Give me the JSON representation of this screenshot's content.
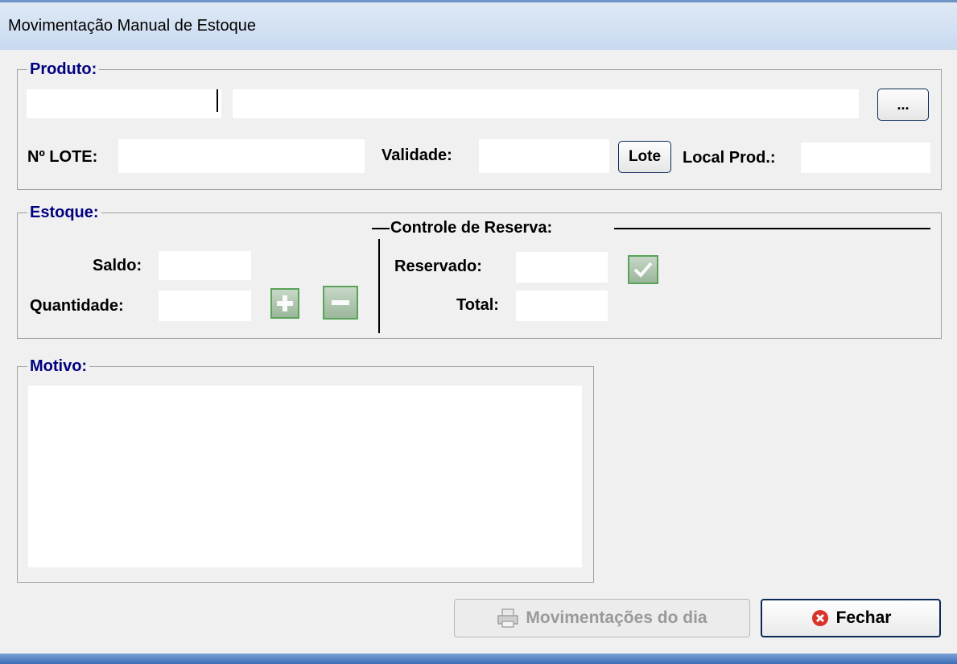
{
  "window": {
    "title": "Movimentação Manual de Estoque"
  },
  "produto": {
    "legend": "Produto:",
    "code_value": "",
    "description_value": "",
    "browse_label": "...",
    "lote_label": "Nº LOTE:",
    "lote_value": "",
    "validade_label": "Validade:",
    "validade_value": "",
    "lote_button": "Lote",
    "local_label": "Local Prod.:",
    "local_value": ""
  },
  "estoque": {
    "legend": "Estoque:",
    "saldo_label": "Saldo:",
    "saldo_value": "",
    "quantidade_label": "Quantidade:",
    "quantidade_value": "",
    "add_icon": "plus-icon",
    "remove_icon": "minus-icon",
    "reserva": {
      "title": "Controle de Reserva:",
      "reservado_label": "Reservado:",
      "reservado_value": "",
      "total_label": "Total:",
      "total_value": "",
      "confirm_icon": "checkmark-icon"
    }
  },
  "motivo": {
    "legend": "Motivo:",
    "value": ""
  },
  "footer": {
    "movimentacoes_label": "Movimentações do dia",
    "movimentacoes_icon": "printer-icon",
    "fechar_label": "Fechar",
    "fechar_icon": "close-icon"
  },
  "colors": {
    "legend": "#000080",
    "accent_border": "#0b2a5a",
    "green_button": "#5aa35a",
    "close_red": "#d9342b"
  }
}
